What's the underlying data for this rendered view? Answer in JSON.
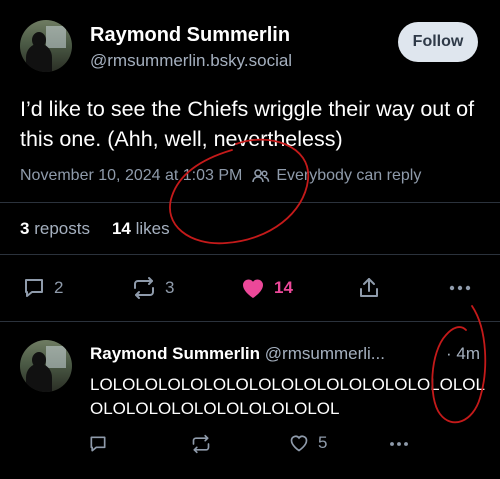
{
  "post": {
    "author_name": "Raymond Summerlin",
    "author_handle": "@rmsummerlin.bsky.social",
    "follow_label": "Follow",
    "text": "I’d like to see the Chiefs wriggle their way out of this one. (Ahh, well, nevertheless)",
    "timestamp": "November 10, 2024 at 1:03 PM",
    "reply_setting_icon": "people-icon",
    "reply_setting": "Everybody can reply",
    "reposts_count": "3",
    "reposts_label": "reposts",
    "likes_count": "14",
    "likes_label": "likes",
    "actions": {
      "reply_count": "2",
      "repost_count": "3",
      "like_count": "14",
      "like_color": "#ec4899"
    }
  },
  "reply": {
    "author_name": "Raymond Summerlin",
    "author_handle": "@rmsummerli...",
    "age": "· 4m",
    "text": "LOLOLOLOLOLOLOLOLOLOLOLOLOLOLOLOLOLOLOLOLOLOLOLOLOLOLOLOL",
    "actions": {
      "like_count": "5"
    }
  },
  "colors": {
    "background": "#000000",
    "annotation_ink": "#c41a1a"
  }
}
